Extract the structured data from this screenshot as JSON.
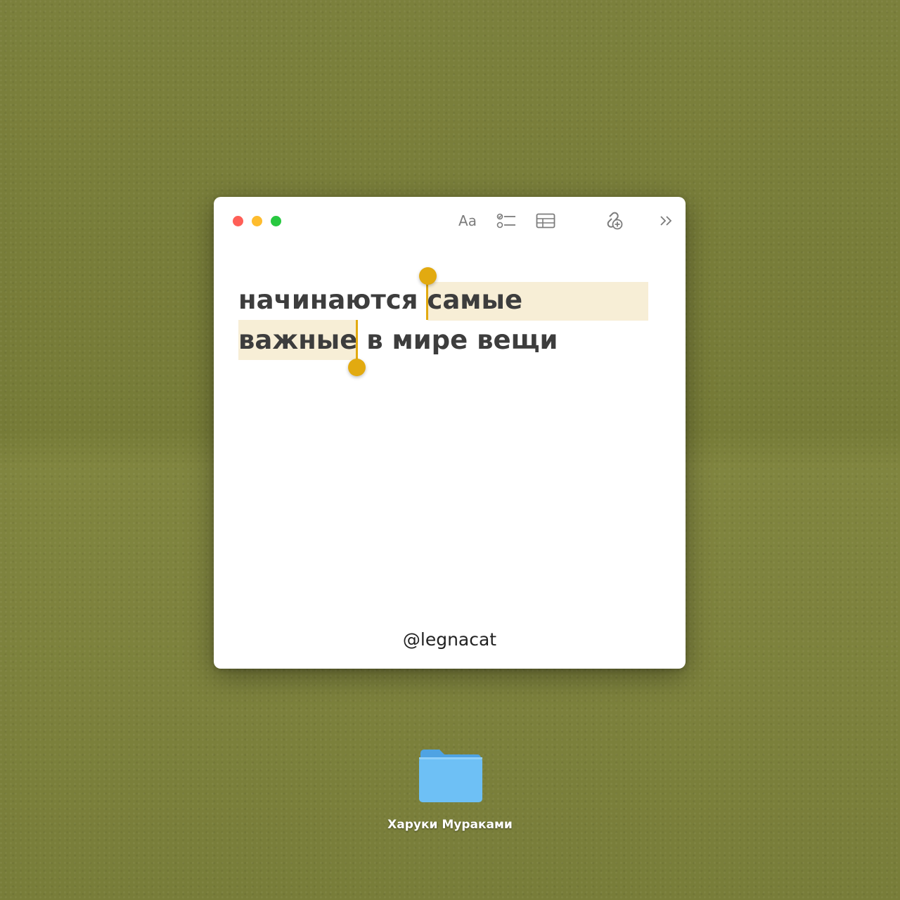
{
  "window": {
    "toolbar": {
      "format_label": "Aa",
      "icons": [
        "checklist-icon",
        "table-icon",
        "collaborate-icon",
        "chevron-more-icon"
      ]
    },
    "note": {
      "line1_plain": "начинаются ",
      "line1_selected": "самые",
      "line2_selected": "важные",
      "line2_plain": " в мире вещи"
    },
    "watermark": "@legnacat"
  },
  "desktop": {
    "folder_label": "Харуки Мураками"
  },
  "colors": {
    "background": "#7a7f3a",
    "selection": "#f7eed6",
    "handle": "#e2aa10",
    "folder": "#6ec0f5"
  }
}
